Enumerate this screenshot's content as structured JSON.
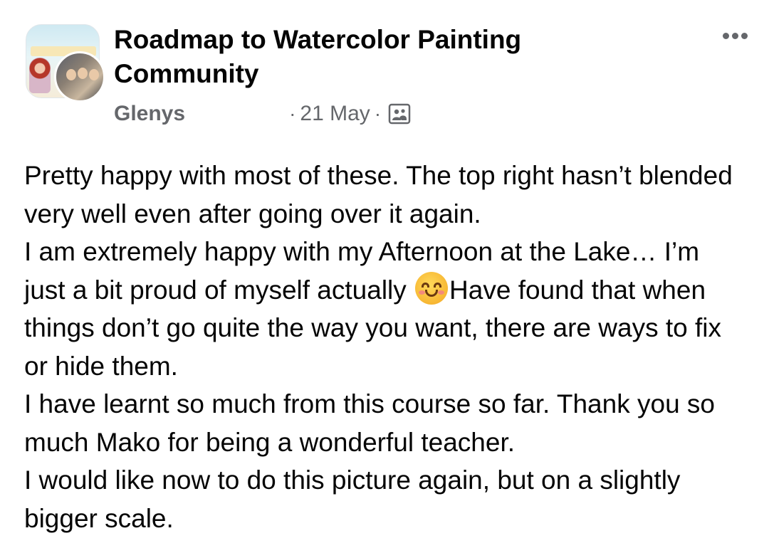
{
  "post": {
    "group_name_line1": "Roadmap to Watercolor Painting",
    "group_name_line2": "Community",
    "author": "Glenys",
    "separator": "·",
    "date": "21 May",
    "audience_icon": "group-members-icon",
    "more_icon": "more-options-icon",
    "emoji": "smiling-face-emoji",
    "text": {
      "part1": "Pretty happy with most of these. The top right hasn’t blended very well even after going over it again.",
      "part2": "I am extremely happy with my Afternoon at the Lake… I’m just a bit proud of myself actually ",
      "part3": "Have found that when things don’t go quite the way you want, there are ways to fix or hide them.",
      "part4": "I have learnt so much from this course so far. Thank you so much Mako for being a wonderful teacher.",
      "part5": "I would like now to do this picture again, but on a slightly bigger scale."
    }
  },
  "colors": {
    "primary_text": "#050505",
    "secondary_text": "#65676b",
    "background": "#ffffff"
  }
}
